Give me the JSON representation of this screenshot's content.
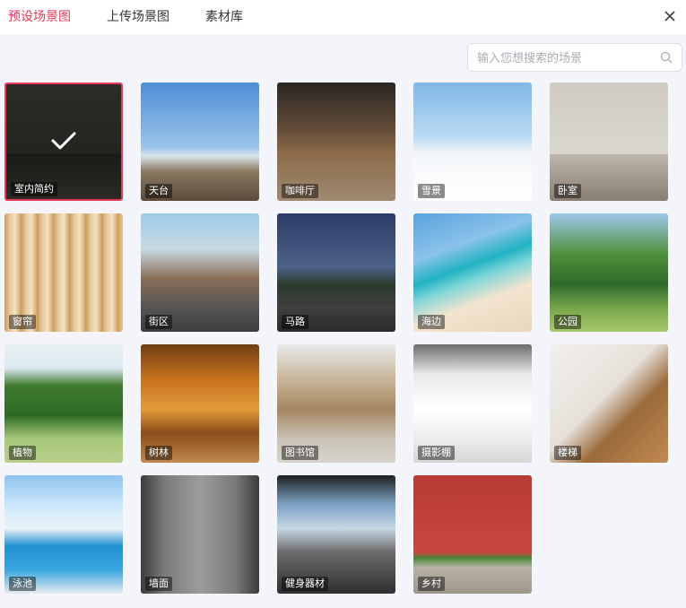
{
  "header": {
    "tabs": [
      {
        "label": "预设场景图",
        "active": true
      },
      {
        "label": "上传场景图",
        "active": false
      },
      {
        "label": "素材库",
        "active": false
      }
    ],
    "close_icon": "close-icon"
  },
  "search": {
    "placeholder": "输入您想搜索的场景",
    "value": "",
    "icon": "search-icon"
  },
  "accent_color": "#e8375a",
  "scenes": [
    {
      "label": "室内简约",
      "selected": true
    },
    {
      "label": "天台",
      "selected": false
    },
    {
      "label": "咖啡厅",
      "selected": false
    },
    {
      "label": "雪景",
      "selected": false
    },
    {
      "label": "卧室",
      "selected": false
    },
    {
      "label": "窗帘",
      "selected": false
    },
    {
      "label": "街区",
      "selected": false
    },
    {
      "label": "马路",
      "selected": false
    },
    {
      "label": "海边",
      "selected": false
    },
    {
      "label": "公园",
      "selected": false
    },
    {
      "label": "植物",
      "selected": false
    },
    {
      "label": "树林",
      "selected": false
    },
    {
      "label": "图书馆",
      "selected": false
    },
    {
      "label": "摄影棚",
      "selected": false
    },
    {
      "label": "楼梯",
      "selected": false
    },
    {
      "label": "泳池",
      "selected": false
    },
    {
      "label": "墙面",
      "selected": false
    },
    {
      "label": "健身器材",
      "selected": false
    },
    {
      "label": "乡村",
      "selected": false
    }
  ]
}
